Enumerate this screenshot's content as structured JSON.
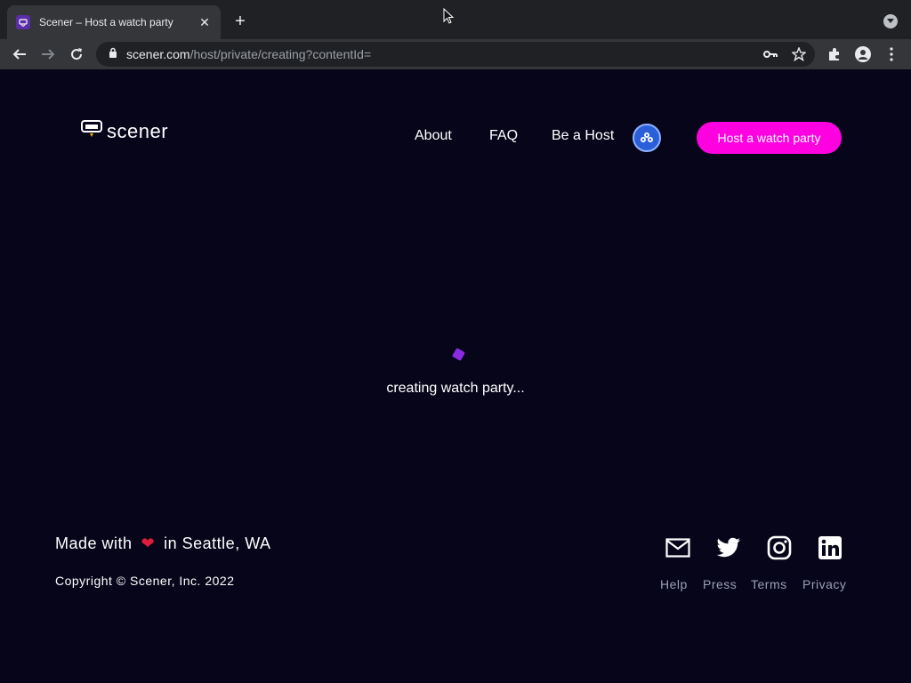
{
  "browser": {
    "tab_title": "Scener – Host a watch party",
    "tab_close": "✕",
    "new_tab": "+",
    "url_host": "scener.com",
    "url_path": "/host/private/creating?contentId="
  },
  "site": {
    "logo_text": "scener",
    "nav": {
      "about": "About",
      "faq": "FAQ",
      "be_host": "Be a Host"
    },
    "host_button": "Host a watch party",
    "status_text": "creating watch party...",
    "footer": {
      "made_prefix": "Made with",
      "heart": "❤",
      "made_suffix": "in Seattle, WA",
      "copyright": "Copyright © Scener, Inc. 2022",
      "links": {
        "help": "Help",
        "press": "Press",
        "terms": "Terms",
        "privacy": "Privacy"
      }
    }
  },
  "colors": {
    "background": "#07051a",
    "accent": "#ff00e1",
    "spinner": "#8a2be2"
  },
  "icons": [
    "scener-favicon",
    "close-icon",
    "plus-icon",
    "tab-search-icon",
    "back-arrow-icon",
    "forward-arrow-icon",
    "reload-icon",
    "lock-icon",
    "key-icon",
    "star-icon",
    "extensions-icon",
    "profile-icon",
    "more-vert-icon",
    "globe-icon",
    "mail-icon",
    "twitter-icon",
    "instagram-icon",
    "linkedin-icon"
  ]
}
